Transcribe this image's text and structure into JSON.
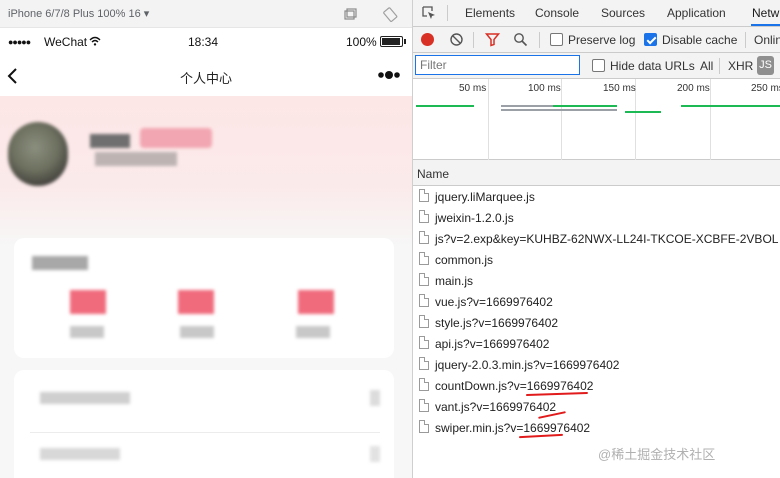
{
  "device_toolbar": {
    "device_label": "iPhone 6/7/8 Plus 100% 16 ▾"
  },
  "phone": {
    "status": {
      "signal": "●●●●●",
      "carrier": "WeChat",
      "time": "18:34",
      "battery": "100%"
    },
    "nav": {
      "title": "个人中心",
      "more": "●●●"
    }
  },
  "devtools": {
    "tabs": [
      "Elements",
      "Console",
      "Sources",
      "Application",
      "Netw"
    ],
    "active_tab": "Netw",
    "toolbar": {
      "preserve_log_label": "Preserve log",
      "preserve_log_checked": false,
      "disable_cache_label": "Disable cache",
      "disable_cache_checked": true,
      "online_label": "Onlin"
    },
    "filterbar": {
      "filter_placeholder": "Filter",
      "hide_data_urls_label": "Hide data URLs",
      "hide_data_urls_checked": false,
      "all_label": "All",
      "xhr_label": "XHR",
      "js_label": "JS"
    },
    "overview_ticks": [
      "50 ms",
      "100 ms",
      "150 ms",
      "200 ms",
      "250 ms"
    ],
    "table": {
      "name_header": "Name",
      "rows": [
        "jquery.liMarquee.js",
        "jweixin-1.2.0.js",
        "js?v=2.exp&key=KUHBZ-62NWX-LL24I-TKCOE-XCBFE-2VBOL",
        "common.js",
        "main.js",
        "vue.js?v=1669976402",
        "style.js?v=1669976402",
        "api.js?v=1669976402",
        "jquery-2.0.3.min.js?v=1669976402",
        "countDown.js?v=1669976402",
        "vant.js?v=1669976402",
        "swiper.min.js?v=1669976402"
      ]
    },
    "colors": {
      "accent": "#1a73e8",
      "record": "#d93025",
      "annotation": "#e11b1b",
      "waterfall": "#1db954"
    }
  },
  "watermark": "@稀土掘金技术社区"
}
